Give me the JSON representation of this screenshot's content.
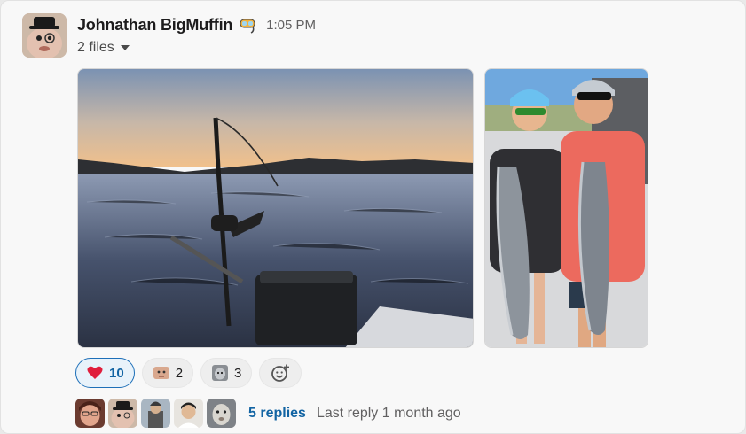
{
  "message": {
    "author": "Johnathan BigMuffin",
    "status_emoji": "snorkel-mask-emoji",
    "timestamp": "1:05 PM",
    "files_label": "2 files",
    "attachments": [
      {
        "name": "sunset-fishing-rod-photo"
      },
      {
        "name": "two-anglers-holding-salmon-photo"
      }
    ]
  },
  "reactions": [
    {
      "emoji": "heart",
      "count": "10",
      "active": true
    },
    {
      "emoji": "custom-face",
      "count": "2",
      "active": false
    },
    {
      "emoji": "custom-pet",
      "count": "3",
      "active": false
    }
  ],
  "add_reaction_icon": "add-emoji-icon",
  "thread": {
    "participants": [
      "avatar-1",
      "avatar-2",
      "avatar-3",
      "avatar-4",
      "avatar-5"
    ],
    "replies_label": "5 replies",
    "last_reply": "Last reply 1 month ago"
  },
  "colors": {
    "link": "#1264a3",
    "heart": "#e01e5a",
    "active_reaction_border": "#1d6fb8"
  }
}
